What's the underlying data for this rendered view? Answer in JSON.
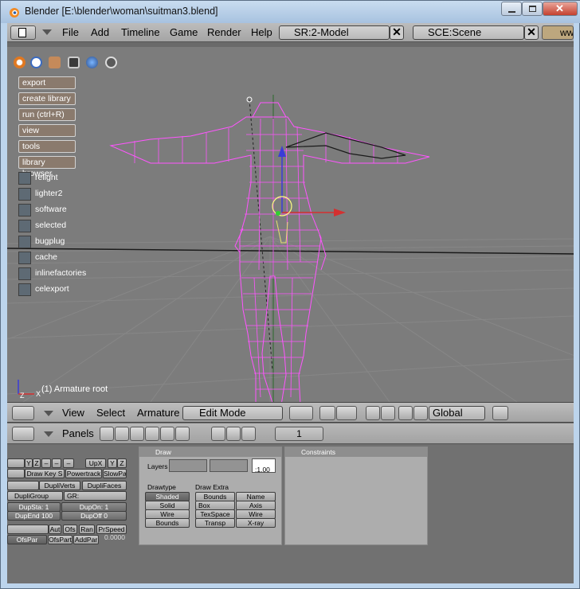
{
  "window": {
    "title": "Blender [E:\\blender\\woman\\suitman3.blend]"
  },
  "topbar": {
    "menus": [
      "File",
      "Add",
      "Timeline",
      "Game",
      "Render",
      "Help"
    ],
    "screen_field": "SR:2-Model",
    "scene_field": "SCE:Scene",
    "cut_label": "ww"
  },
  "viewport": {
    "script_buttons": [
      "export",
      "create library",
      "run (ctrl+R)",
      "view",
      "tools",
      "library browser"
    ],
    "toggles": [
      "relight",
      "lighter2",
      "software",
      "selected",
      "bugplug",
      "cache",
      "inlinefactories",
      "celexport"
    ],
    "status": "(1) Armature root",
    "axis_labels": {
      "z": "Z",
      "x": "X"
    }
  },
  "view_header": {
    "menus": [
      "View",
      "Select",
      "Armature"
    ],
    "mode": "Edit Mode",
    "orientation": "Global"
  },
  "buttons_header": {
    "panels_label": "Panels",
    "frame": "1"
  },
  "left_panel": {
    "row1": [
      "Y",
      "Z",
      "–",
      "–",
      "–",
      "UpX",
      "Y",
      "Z"
    ],
    "row2": [
      "Draw Key S",
      "Powertrack",
      "SlowPa"
    ],
    "row3": [
      "DupliVerts",
      "DupliFaces"
    ],
    "row4": [
      "DupliGroup",
      "GR:"
    ],
    "row5": [
      "DupSta: 1",
      "DupOn: 1"
    ],
    "row6": [
      "DupEnd 100",
      "DupOff 0"
    ],
    "row7": [
      "Aut",
      "Ofs",
      "Ran",
      "PrSpeed"
    ],
    "row8": [
      "OfsPar",
      "OfsPart",
      "AddPar"
    ],
    "value": "0.0000"
  },
  "draw_panel": {
    "title": "Draw",
    "layers_label": "Layers",
    "layer_value": ":1.00",
    "drawtype_label": "Drawtype",
    "drawtypes": [
      "Shaded",
      "Solid",
      "Wire",
      "Bounds"
    ],
    "draw_extra_label": "Draw Extra",
    "extra_left": [
      "Bounds",
      "Box",
      "TexSpace",
      "Transp"
    ],
    "extra_right": [
      "Name",
      "Axis",
      "Wire",
      "X-ray"
    ]
  },
  "constraints_panel": {
    "title": "Constraints"
  },
  "colors": {
    "mesh": "#ff55ff",
    "viewport": "#7c7c7c",
    "header": "#b0b0b0"
  }
}
